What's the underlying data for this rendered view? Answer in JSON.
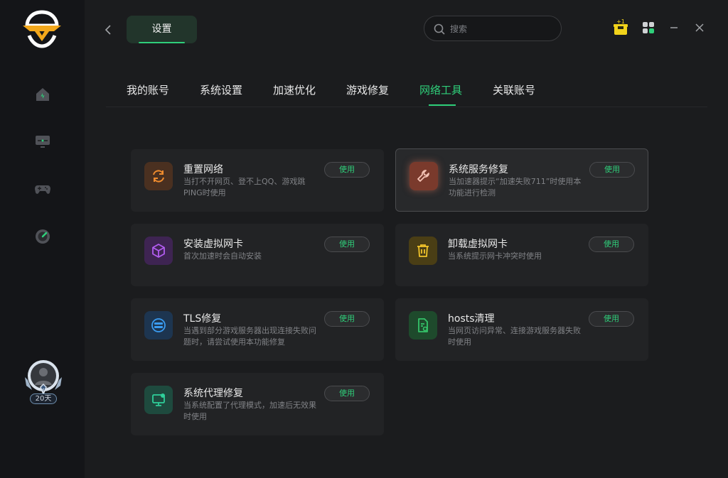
{
  "sidebar": {
    "logo_icon": "winged-v-logo",
    "nav": [
      {
        "icon": "home-icon"
      },
      {
        "icon": "monitor-icon"
      },
      {
        "icon": "gamepad-icon"
      },
      {
        "icon": "speedometer-icon"
      }
    ],
    "avatar": {
      "days_label": "20天"
    }
  },
  "header": {
    "title": "设置",
    "search_placeholder": "搜索",
    "gift_badge": "+1"
  },
  "tabs": [
    {
      "label": "我的账号",
      "active": false
    },
    {
      "label": "系统设置",
      "active": false
    },
    {
      "label": "加速优化",
      "active": false
    },
    {
      "label": "游戏修复",
      "active": false
    },
    {
      "label": "网络工具",
      "active": true
    },
    {
      "label": "关联账号",
      "active": false
    }
  ],
  "tools": [
    {
      "title": "重置网络",
      "desc": "当打不开网页、登不上QQ、游戏跳PING时使用",
      "button": "使用",
      "icon": "refresh-icon",
      "color": "#f08c2e"
    },
    {
      "title": "系统服务修复",
      "desc": "当加速器提示“加速失败711”时使用本功能进行检测",
      "button": "使用",
      "icon": "wrench-icon",
      "color": "#e8795d"
    },
    {
      "title": "安装虚拟网卡",
      "desc": "首次加速时会自动安装",
      "button": "使用",
      "icon": "cube-icon",
      "color": "#b25cf0"
    },
    {
      "title": "卸载虚拟网卡",
      "desc": "当系统提示网卡冲突时使用",
      "button": "使用",
      "icon": "trash-icon",
      "color": "#f2c42a"
    },
    {
      "title": "TLS修复",
      "desc": "当遇到部分游戏服务器出现连接失败问题时，请尝试使用本功能修复",
      "button": "使用",
      "icon": "tls-icon",
      "color": "#3a9bf0"
    },
    {
      "title": "hosts清理",
      "desc": "当网页访问异常、连接游戏服务器失败时使用",
      "button": "使用",
      "icon": "file-clean-icon",
      "color": "#35c46a"
    },
    {
      "title": "系统代理修复",
      "desc": "当系统配置了代理模式，加速后无效果时使用",
      "button": "使用",
      "icon": "monitor-proxy-icon",
      "color": "#2fcf9a"
    }
  ]
}
